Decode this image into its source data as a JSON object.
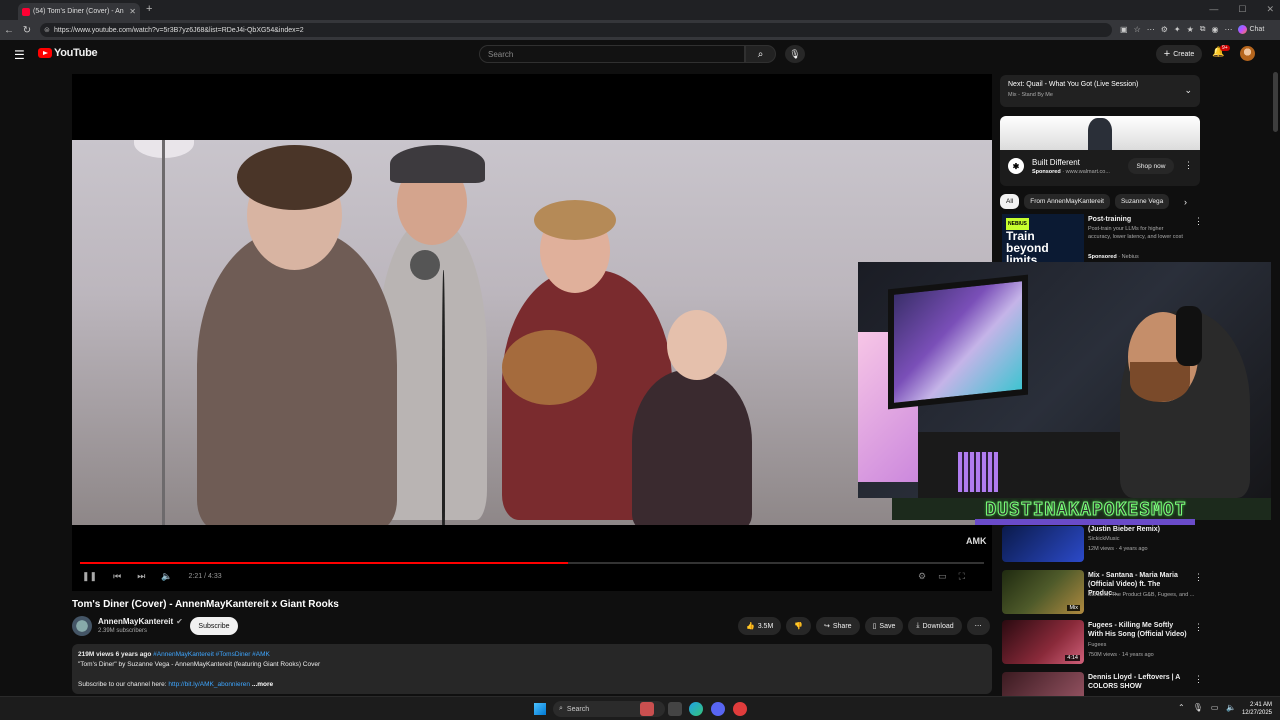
{
  "browser": {
    "tab_title": "(54) Tom's Diner (Cover) - An",
    "url": "https://www.youtube.com/watch?v=5r3B7yz6J68&list=RDeJ4i-QbXG54&index=2",
    "chat_label": "Chat"
  },
  "header": {
    "logo_text": "YouTube",
    "search_placeholder": "Search",
    "create_label": "Create",
    "notif_count": "9+"
  },
  "player": {
    "watermark": "AMK",
    "time": "2:21 / 4:33",
    "progress_fraction": 0.54
  },
  "video": {
    "title": "Tom's Diner (Cover) - AnnenMayKantereit x Giant Rooks",
    "channel": "AnnenMayKantereit",
    "subscribers": "2.39M subscribers",
    "subscribe_label": "Subscribe",
    "likes": "3.5M",
    "share_label": "Share",
    "save_label": "Save",
    "download_label": "Download"
  },
  "description": {
    "stats": "219M views  6 years ago",
    "tags": "#AnnenMayKantereit #TomsDiner #AMK",
    "line1": "\"Tom's Diner\" by Suzanne Vega - AnnenMayKantereit (featuring Giant Rooks) Cover",
    "line2_prefix": "Subscribe to our channel here: ",
    "line2_link": "http://bit.ly/AMK_abonnieren",
    "more": "...more"
  },
  "next": {
    "title": "Next: Quail - What You Got (Live Session)",
    "sub": "Mix - Stand By Me"
  },
  "ad1": {
    "title": "Built Different",
    "sponsored": "Sponsored",
    "domain": "www.walmart.co...",
    "cta": "Shop now"
  },
  "chips": [
    "All",
    "From AnnenMayKantereit",
    "Suzanne Vega"
  ],
  "ad2": {
    "image_text": "Train beyond limits",
    "tag": "NEBIUS",
    "title": "Post-training",
    "desc": "Post-train your LLMs for higher accuracy, lower latency, and lower cost",
    "sponsored": "Sponsored",
    "advertiser": "Nebius"
  },
  "overlay": {
    "banner": "DUSTINAKAPOKESMOT"
  },
  "recs": [
    {
      "title": "(Justin Bieber Remix)",
      "channel": "SickickMusic",
      "meta": "12M views · 4 years ago",
      "duration": ""
    },
    {
      "title": "Mix - Santana - Maria Maria (Official Video) ft. The Produc...",
      "channel": "Santana, The Product G&B, Fugees, and ...",
      "meta": "",
      "duration": "Mix"
    },
    {
      "title": "Fugees - Killing Me Softly With His Song (Official Video)",
      "channel": "Fugees",
      "meta": "750M views · 14 years ago",
      "duration": "4:14"
    },
    {
      "title": "Dennis Lloyd - Leftovers | A COLORS SHOW",
      "channel": "",
      "meta": "",
      "duration": ""
    }
  ],
  "taskbar": {
    "search": "Search",
    "time": "2:41 AM",
    "date": "12/27/2025"
  }
}
